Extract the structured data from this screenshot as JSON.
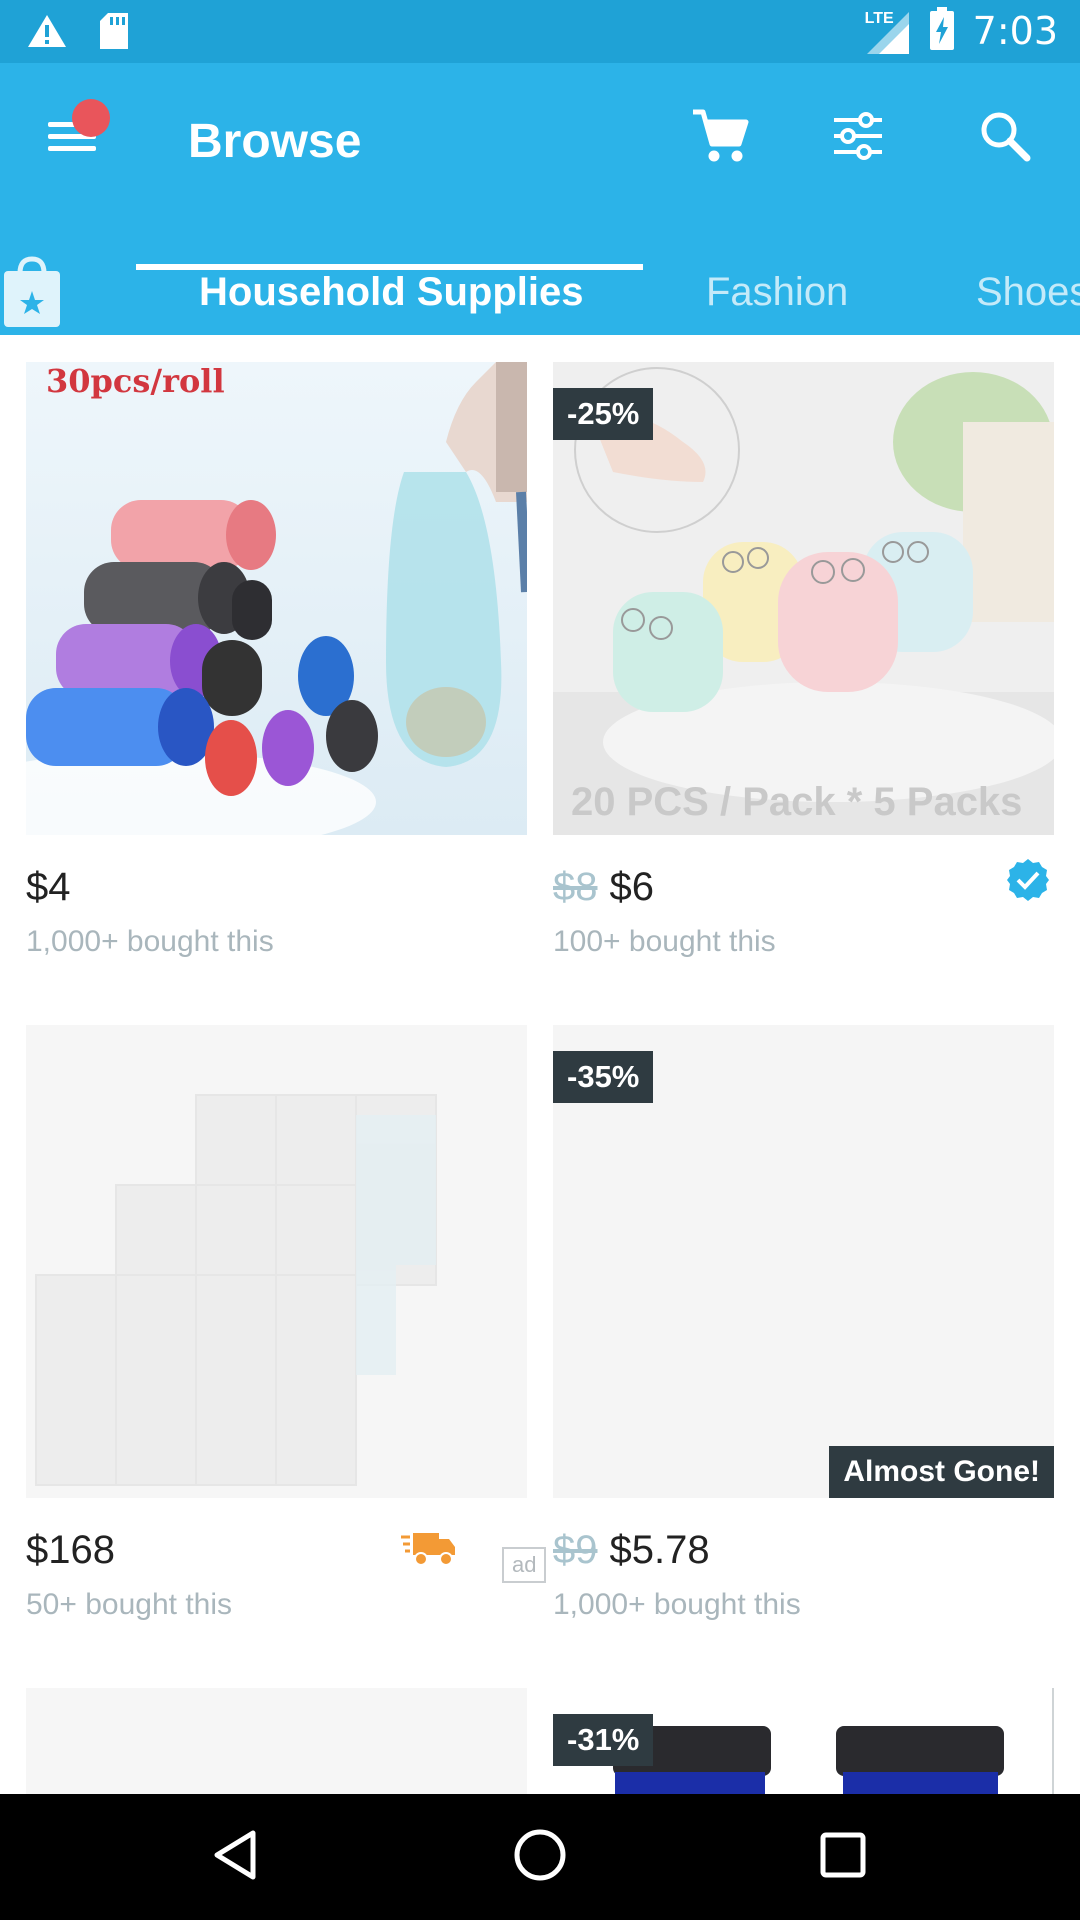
{
  "status_bar": {
    "time": "7:03",
    "network": "LTE",
    "icons": [
      "alert-icon",
      "sd-card-icon",
      "signal-icon",
      "battery-charging-icon"
    ]
  },
  "app_bar": {
    "title": "Browse",
    "icons": [
      "menu-icon",
      "cart-icon",
      "filter-icon",
      "search-icon"
    ],
    "notification_dot_color": "#e9555b"
  },
  "tabs": {
    "items": [
      "Household Supplies",
      "Fashion",
      "Shoes"
    ],
    "active_index": 0
  },
  "products": [
    {
      "image_caption": "30pcs/roll",
      "price": "$4",
      "bought": "1,000+ bought this"
    },
    {
      "discount": "-25%",
      "image_caption": "20 PCS / Pack * 5 Packs",
      "old_price": "$8",
      "price": "$6",
      "bought": "100+ bought this",
      "verified": true
    },
    {
      "price": "$168",
      "bought": "50+ bought this",
      "ad": "ad",
      "fast_shipping": true
    },
    {
      "discount": "-35%",
      "overlay_label": "Almost Gone!",
      "old_price": "$9",
      "price": "$5.78",
      "bought": "1,000+ bought this"
    },
    {},
    {
      "discount": "-31%"
    }
  ],
  "colors": {
    "status_bar": "#1fa2d6",
    "app_bar": "#2cb3e8",
    "accent_badge": "#2f3b41",
    "verified": "#2cb3e8",
    "truck": "#f39a35"
  },
  "nav_bar": {
    "icons": [
      "back-icon",
      "home-icon",
      "recents-icon"
    ]
  }
}
